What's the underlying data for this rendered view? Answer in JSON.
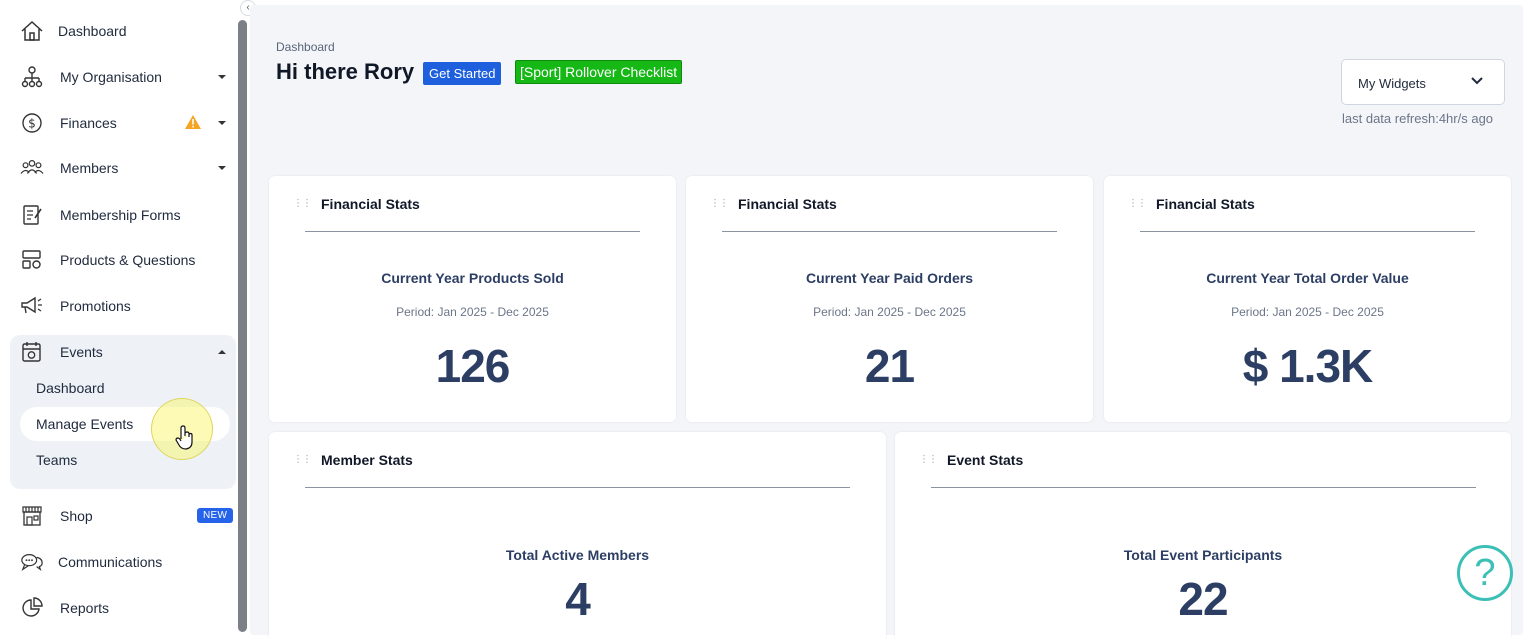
{
  "sidebar": {
    "items": [
      {
        "label": "Dashboard",
        "icon": "home-icon"
      },
      {
        "label": "My Organisation",
        "icon": "org-chart-icon"
      },
      {
        "label": "Finances",
        "icon": "dollar-icon"
      },
      {
        "label": "Members",
        "icon": "users-icon"
      },
      {
        "label": "Membership Forms",
        "icon": "form-icon"
      },
      {
        "label": "Products & Questions",
        "icon": "products-icon"
      },
      {
        "label": "Promotions",
        "icon": "megaphone-icon"
      },
      {
        "label": "Events",
        "icon": "calendar-icon"
      },
      {
        "label": "Shop",
        "icon": "shop-icon",
        "badge": "NEW"
      },
      {
        "label": "Communications",
        "icon": "chat-icon"
      },
      {
        "label": "Reports",
        "icon": "pie-chart-icon"
      }
    ],
    "events_sub": [
      "Dashboard",
      "Manage Events",
      "Teams"
    ]
  },
  "header": {
    "breadcrumb": "Dashboard",
    "greeting": "Hi there Rory",
    "get_started": "Get Started",
    "rollover": "[Sport] Rollover Checklist",
    "widgets_label": "My Widgets",
    "refresh": "last data refresh:4hr/s ago"
  },
  "cards": [
    {
      "title": "Financial Stats",
      "metric": "Current Year Products Sold",
      "period": "Period: Jan 2025 - Dec 2025",
      "value": "126"
    },
    {
      "title": "Financial Stats",
      "metric": "Current Year Paid Orders",
      "period": "Period: Jan 2025 - Dec 2025",
      "value": "21"
    },
    {
      "title": "Financial Stats",
      "metric": "Current Year Total Order Value",
      "period": "Period: Jan 2025 - Dec 2025",
      "value": "$ 1.3K"
    },
    {
      "title": "Member Stats",
      "metric": "Total Active Members",
      "value": "4"
    },
    {
      "title": "Event Stats",
      "metric": "Total Event Participants",
      "value": "22"
    }
  ],
  "help": "?",
  "colors": {
    "primary": "#1d5fdc",
    "rollover": "#16b816",
    "metric": "#2c3e63",
    "help": "#3bbfb6",
    "warning": "#f5a524"
  }
}
